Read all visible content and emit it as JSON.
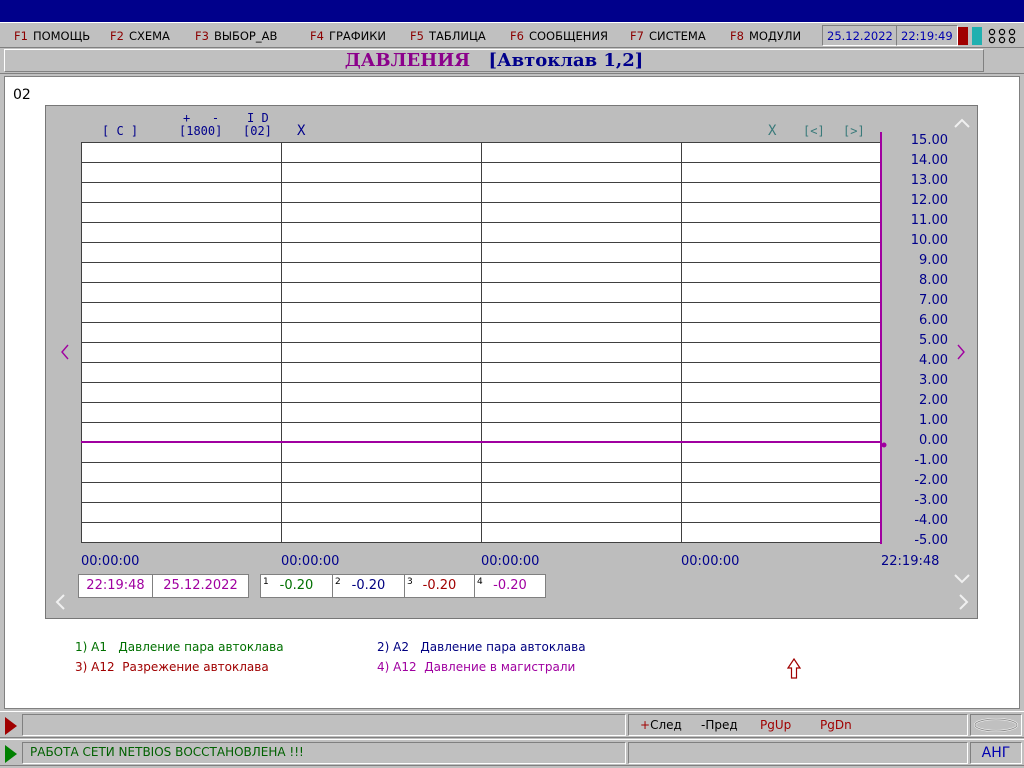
{
  "menu": {
    "items": [
      {
        "key": "F1",
        "label": "ПОМОЩЬ"
      },
      {
        "key": "F2",
        "label": "СХЕМА"
      },
      {
        "key": "F3",
        "label": "ВЫБОР_АВ"
      },
      {
        "key": "F4",
        "label": "ГРАФИКИ"
      },
      {
        "key": "F5",
        "label": "ТАБЛИЦА"
      },
      {
        "key": "F6",
        "label": "СООБЩЕНИЯ"
      },
      {
        "key": "F7",
        "label": "СИСТЕМА"
      },
      {
        "key": "F8",
        "label": "МОДУЛИ"
      }
    ],
    "date": "25.12.2022",
    "time": "22:19:49",
    "indicator_colors": [
      "#a00000",
      "#20b0b0"
    ],
    "circles": "o o o\no o o",
    "circles_icon": "grid-circles-icon"
  },
  "page": {
    "title": "ДАВЛЕНИЯ",
    "subtitle": "[Автоклав  1,2]",
    "id": "02"
  },
  "chart_header": {
    "mode": "[ C ]",
    "plus_minus": "+   -",
    "range": "[1800]",
    "id_label": "I D",
    "id_value": "[02]",
    "x_left": "X",
    "x_right": "X",
    "nav_prev": "[<]",
    "nav_next": "[>]"
  },
  "chart_data": {
    "type": "line",
    "ylim": [
      -5,
      15
    ],
    "y_ticks": [
      "15.00",
      "14.00",
      "13.00",
      "12.00",
      "11.00",
      "10.00",
      "9.00",
      "8.00",
      "7.00",
      "6.00",
      "5.00",
      "4.00",
      "3.00",
      "2.00",
      "1.00",
      "0.00",
      "-1.00",
      "-2.00",
      "-3.00",
      "-4.00",
      "-5.00"
    ],
    "x_ticks": [
      "00:00:00",
      "00:00:00",
      "00:00:00",
      "00:00:00",
      "22:19:48"
    ],
    "grid": true,
    "series": [
      {
        "color": "#a000a0",
        "values": [
          0.0,
          0.0,
          0.0,
          0.0,
          0.0
        ]
      }
    ]
  },
  "cursor": {
    "time": "22:19:48",
    "date": "25.12.2022",
    "values": [
      {
        "n": "1",
        "value": "-0.20",
        "color": "#007000"
      },
      {
        "n": "2",
        "value": "-0.20",
        "color": "#000080"
      },
      {
        "n": "3",
        "value": "-0.20",
        "color": "#a00000"
      },
      {
        "n": "4",
        "value": "-0.20",
        "color": "#a000a0"
      }
    ]
  },
  "legend": [
    {
      "text": "1) A1   Давление пара автоклава",
      "color": "#007000"
    },
    {
      "text": "2) A2   Давление пара автоклава",
      "color": "#000080"
    },
    {
      "text": "3) A12  Разрежение автоклава",
      "color": "#a00000"
    },
    {
      "text": "4) A12  Давление в магистрали",
      "color": "#a000a0"
    }
  ],
  "status": {
    "message": "РАБОТА СЕТИ NETBIOS ВОССТАНОВЛЕНА !!!",
    "next": "+След",
    "prev": "-Пред",
    "pgup": "PgUp",
    "pgdn": "PgDn",
    "lang": "АНГ",
    "message_color": "#006000",
    "triangle_top_color": "#a00000",
    "triangle_bottom_color": "#008000"
  }
}
